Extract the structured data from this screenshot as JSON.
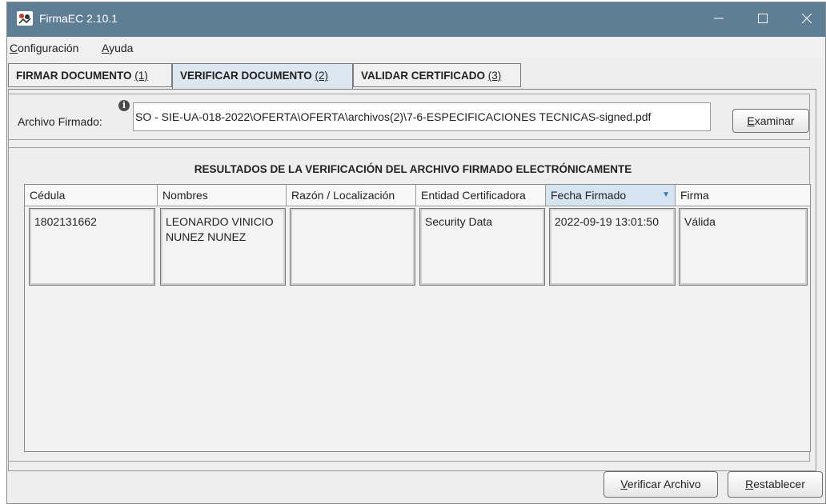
{
  "window": {
    "title": "FirmaEC 2.10.1"
  },
  "menu": [
    {
      "mnemonic": "C",
      "rest": "onfiguración"
    },
    {
      "mnemonic": "A",
      "rest": "yuda"
    }
  ],
  "tabs": [
    {
      "label": "FIRMAR DOCUMENTO",
      "num": "(1)",
      "active": false
    },
    {
      "label": "VERIFICAR DOCUMENTO",
      "num": "(2)",
      "active": true
    },
    {
      "label": "VALIDAR CERTIFICADO",
      "num": "(3)",
      "active": false
    }
  ],
  "file": {
    "label": "Archivo Firmado:",
    "value": "SO - SIE-UA-018-2022\\OFERTA\\OFERTA\\archivos(2)\\7-6-ESPECIFICACIONES TECNICAS-signed.pdf",
    "browse_mnemonic": "E",
    "browse_rest": "xaminar"
  },
  "results": {
    "title": "RESULTADOS DE LA VERIFICACIÓN DEL ARCHIVO FIRMADO ELECTRÓNICAMENTE",
    "columns": [
      "Cédula",
      "Nombres",
      "Razón / Localización",
      "Entidad Certificadora",
      "Fecha Firmado",
      "Firma"
    ],
    "sorted_column": "Fecha Firmado",
    "rows": [
      {
        "cedula": "1802131662",
        "nombres_line1": "LEONARDO VINICIO",
        "nombres_line2": "NUNEZ NUNEZ",
        "razon": "",
        "entidad": "Security Data",
        "fecha": "2022-09-19 13:01:50",
        "firma": "Válida"
      }
    ]
  },
  "buttons": {
    "verify_mnemonic": "V",
    "verify_rest": "erificar Archivo",
    "reset_mnemonic": "R",
    "reset_rest": "establecer"
  },
  "colors": {
    "titlebar": "#5e7e96",
    "sorted_header": "#d6e4f2",
    "active_tab": "#dde7f0"
  }
}
